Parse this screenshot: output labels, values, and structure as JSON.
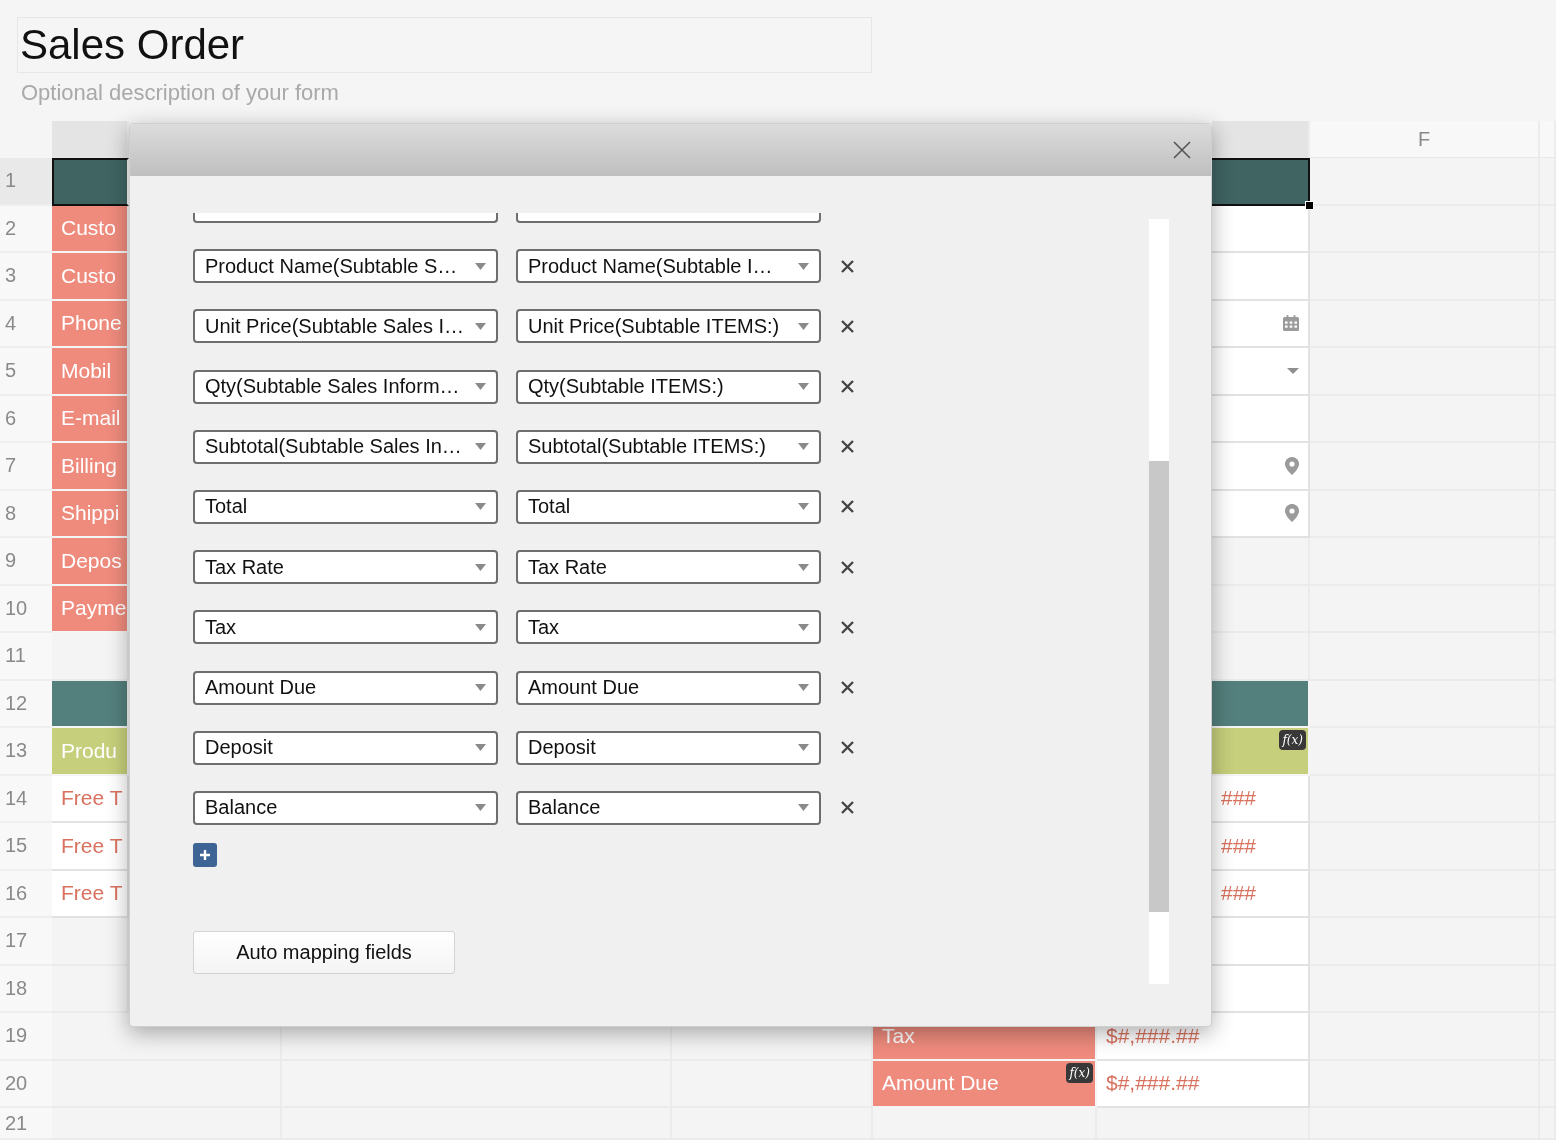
{
  "form": {
    "title": "Sales Order",
    "description": "Optional description of your form"
  },
  "sheet": {
    "column_headers": [
      {
        "selected": true
      },
      {
        "selected": true
      },
      {
        "label": "F",
        "selected": false
      },
      {
        "selected": false
      }
    ],
    "rows": [
      {
        "number": "1",
        "selected": true,
        "cells": [
          {
            "kind": "band"
          },
          {
            "kind": "band"
          }
        ]
      },
      {
        "number": "2",
        "selected": false,
        "cells": [
          {
            "kind": "label",
            "text": "Custo"
          },
          {
            "kind": "input"
          }
        ]
      },
      {
        "number": "3",
        "selected": false,
        "cells": [
          {
            "kind": "label",
            "text": "Custo"
          },
          {
            "kind": "input"
          }
        ]
      },
      {
        "number": "4",
        "selected": false,
        "cells": [
          {
            "kind": "label",
            "text": "Phone"
          },
          {
            "kind": "date"
          }
        ]
      },
      {
        "number": "5",
        "selected": false,
        "cells": [
          {
            "kind": "label",
            "text": "Mobil"
          },
          {
            "kind": "select"
          }
        ]
      },
      {
        "number": "6",
        "selected": false,
        "cells": [
          {
            "kind": "label",
            "text": "E-mail"
          },
          {
            "kind": "input"
          }
        ]
      },
      {
        "number": "7",
        "selected": false,
        "cells": [
          {
            "kind": "label",
            "text": "Billing"
          },
          {
            "kind": "address"
          }
        ]
      },
      {
        "number": "8",
        "selected": false,
        "cells": [
          {
            "kind": "label",
            "text": "Shippi"
          },
          {
            "kind": "address"
          }
        ]
      },
      {
        "number": "9",
        "selected": false,
        "cells": [
          {
            "kind": "label",
            "text": "Depos"
          },
          {
            "kind": "empty"
          }
        ]
      },
      {
        "number": "10",
        "selected": false,
        "cells": [
          {
            "kind": "label",
            "text": "Payme"
          },
          {
            "kind": "empty"
          }
        ]
      },
      {
        "number": "11",
        "selected": false,
        "cells": [
          {
            "kind": "empty"
          },
          {
            "kind": "empty"
          }
        ]
      },
      {
        "number": "12",
        "selected": false,
        "cells": [
          {
            "kind": "band"
          },
          {
            "kind": "band"
          }
        ]
      },
      {
        "number": "13",
        "selected": false,
        "cells": [
          {
            "kind": "section",
            "text": "Produ"
          },
          {
            "kind": "section",
            "formula": "f(x)"
          }
        ]
      },
      {
        "number": "14",
        "selected": false,
        "cells": [
          {
            "kind": "text",
            "text": "Free T"
          },
          {
            "kind": "text",
            "text": "###"
          }
        ]
      },
      {
        "number": "15",
        "selected": false,
        "cells": [
          {
            "kind": "text",
            "text": "Free T"
          },
          {
            "kind": "text",
            "text": "###"
          }
        ]
      },
      {
        "number": "16",
        "selected": false,
        "cells": [
          {
            "kind": "text",
            "text": "Free T"
          },
          {
            "kind": "text",
            "text": "###"
          }
        ]
      },
      {
        "number": "17",
        "selected": false,
        "cells": [
          {
            "kind": "empty"
          },
          {
            "kind": "input"
          }
        ]
      },
      {
        "number": "18",
        "selected": false,
        "cells": [
          {
            "kind": "empty"
          },
          {
            "kind": "input"
          }
        ]
      },
      {
        "number": "19",
        "selected": false,
        "cells": [
          {
            "kind": "empty"
          },
          {
            "kind": "empty"
          },
          {
            "kind": "empty"
          },
          {
            "kind": "label",
            "text": "Tax"
          },
          {
            "kind": "text",
            "text": "$#,###.##"
          }
        ]
      },
      {
        "number": "20",
        "selected": false,
        "cells": [
          {
            "kind": "empty"
          },
          {
            "kind": "empty"
          },
          {
            "kind": "empty"
          },
          {
            "kind": "label",
            "text": "Amount Due",
            "formula": "f(x)"
          },
          {
            "kind": "text",
            "text": "$#,###.##"
          }
        ]
      },
      {
        "number": "21",
        "selected": false,
        "cells": [
          {
            "kind": "empty"
          },
          {
            "kind": "empty"
          },
          {
            "kind": "empty"
          },
          {
            "kind": "empty"
          },
          {
            "kind": "empty"
          }
        ]
      }
    ]
  },
  "dialog": {
    "mappings": [
      {
        "kind": "clipped"
      },
      {
        "kind": "pair",
        "source": "Product Name(Subtable S…",
        "target": "Product Name(Subtable I…"
      },
      {
        "kind": "pair",
        "source": "Unit Price(Subtable Sales I…",
        "target": "Unit Price(Subtable ITEMS:)"
      },
      {
        "kind": "pair",
        "source": "Qty(Subtable Sales Inform…",
        "target": "Qty(Subtable ITEMS:)"
      },
      {
        "kind": "pair",
        "source": "Subtotal(Subtable Sales In…",
        "target": "Subtotal(Subtable ITEMS:)"
      },
      {
        "kind": "pair",
        "source": "Total",
        "target": "Total"
      },
      {
        "kind": "pair",
        "source": "Tax Rate",
        "target": "Tax Rate"
      },
      {
        "kind": "pair",
        "source": "Tax",
        "target": "Tax"
      },
      {
        "kind": "pair",
        "source": "Amount Due",
        "target": "Amount Due"
      },
      {
        "kind": "pair",
        "source": "Deposit",
        "target": "Deposit"
      },
      {
        "kind": "pair",
        "source": "Balance",
        "target": "Balance"
      }
    ],
    "auto_button": "Auto mapping fields"
  }
}
